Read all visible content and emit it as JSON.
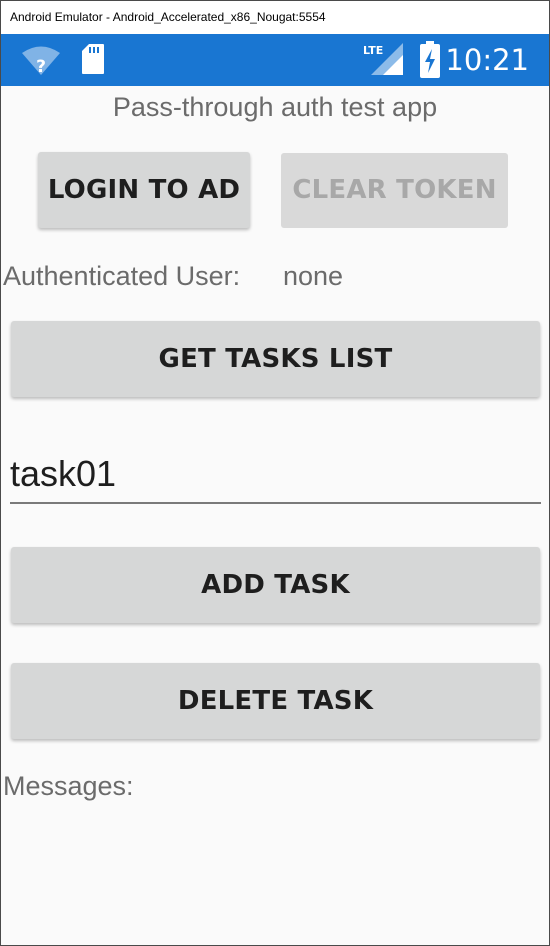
{
  "window": {
    "title": "Android Emulator - Android_Accelerated_x86_Nougat:5554"
  },
  "status_bar": {
    "time": "10:21",
    "network_type": "LTE",
    "background_color": "#1976d2",
    "icons": [
      "wifi-question-icon",
      "sd-card-icon",
      "lte-signal-icon",
      "battery-charging-icon"
    ]
  },
  "app": {
    "title": "Pass-through auth test app",
    "login_button": "LOGIN TO AD",
    "clear_token_button": "CLEAR TOKEN",
    "authenticated_user_label": "Authenticated User:",
    "authenticated_user_value": "none",
    "get_tasks_button": "GET TASKS LIST",
    "task_input_value": "task01",
    "add_task_button": "ADD TASK",
    "delete_task_button": "DELETE TASK",
    "messages_label": "Messages:"
  }
}
